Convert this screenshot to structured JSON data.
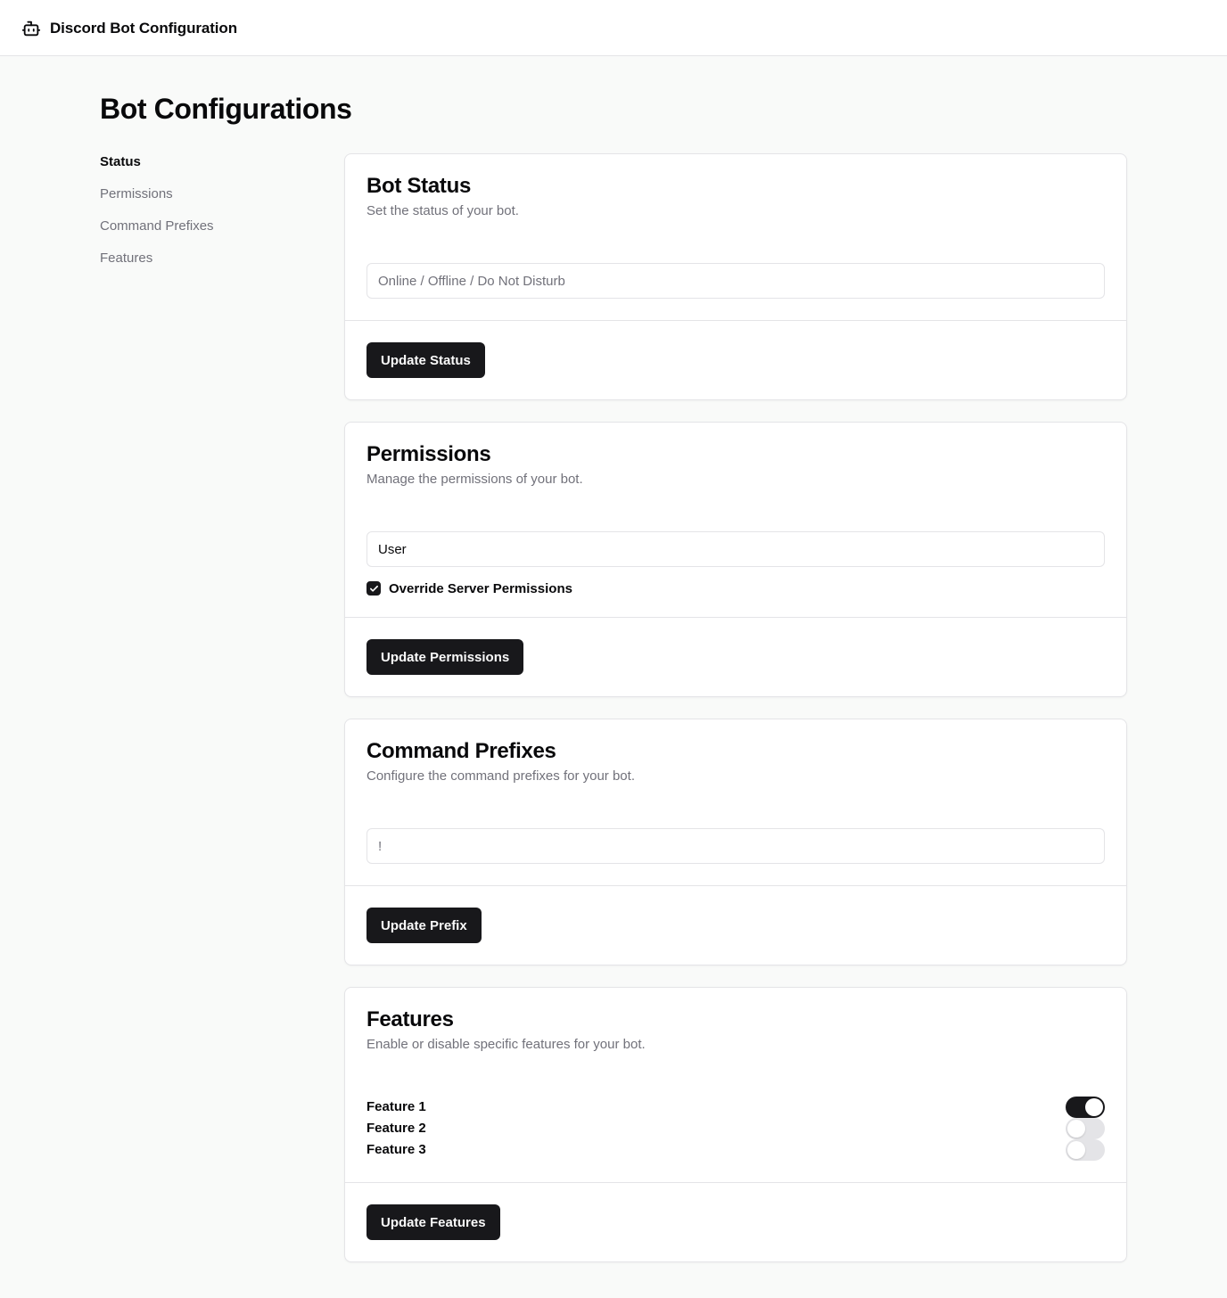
{
  "header": {
    "icon": "bot-icon",
    "title": "Discord Bot Configuration"
  },
  "page": {
    "title": "Bot Configurations"
  },
  "sidebar": {
    "items": [
      {
        "label": "Status",
        "active": true
      },
      {
        "label": "Permissions",
        "active": false
      },
      {
        "label": "Command Prefixes",
        "active": false
      },
      {
        "label": "Features",
        "active": false
      }
    ]
  },
  "status_card": {
    "title": "Bot Status",
    "description": "Set the status of your bot.",
    "input_value": "",
    "input_placeholder": "Online / Offline / Do Not Disturb",
    "button_label": "Update Status"
  },
  "permissions_card": {
    "title": "Permissions",
    "description": "Manage the permissions of your bot.",
    "input_value": "User",
    "checkbox_label": "Override Server Permissions",
    "checkbox_checked": true,
    "button_label": "Update Permissions"
  },
  "prefix_card": {
    "title": "Command Prefixes",
    "description": "Configure the command prefixes for your bot.",
    "input_value": "",
    "input_placeholder": "!",
    "button_label": "Update Prefix"
  },
  "features_card": {
    "title": "Features",
    "description": "Enable or disable specific features for your bot.",
    "features": [
      {
        "label": "Feature 1",
        "enabled": true
      },
      {
        "label": "Feature 2",
        "enabled": false
      },
      {
        "label": "Feature 3",
        "enabled": false
      }
    ],
    "button_label": "Update Features"
  },
  "colors": {
    "primary": "#18181b",
    "border": "#e4e4e7",
    "muted_text": "#71717a",
    "page_background": "#f9faf9"
  }
}
